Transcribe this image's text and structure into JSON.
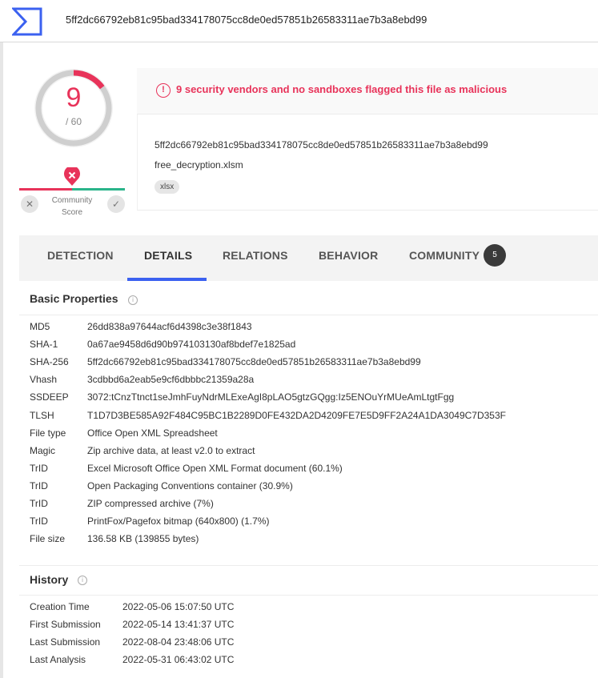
{
  "search": {
    "value": "5ff2dc66792eb81c95bad334178075cc8de0ed57851b26583311ae7b3a8ebd99"
  },
  "score": {
    "detected": "9",
    "total": "/ 60",
    "fraction": 0.15,
    "color": "#e8335a"
  },
  "community": {
    "label_line1": "Community",
    "label_line2": "Score",
    "down_icon": "close-icon",
    "up_icon": "check-icon"
  },
  "alert": {
    "text": "9 security vendors and no sandboxes flagged this file as malicious",
    "icon": "!"
  },
  "file": {
    "hash": "5ff2dc66792eb81c95bad334178075cc8de0ed57851b26583311ae7b3a8ebd99",
    "name": "free_decryption.xlsm",
    "tag": "xlsx"
  },
  "tabs": [
    {
      "label": "DETECTION"
    },
    {
      "label": "DETAILS"
    },
    {
      "label": "RELATIONS"
    },
    {
      "label": "BEHAVIOR"
    },
    {
      "label": "COMMUNITY"
    }
  ],
  "community_count": "5",
  "basic": {
    "title": "Basic Properties",
    "rows": [
      {
        "k": "MD5",
        "v": "26dd838a97644acf6d4398c3e38f1843"
      },
      {
        "k": "SHA-1",
        "v": "0a67ae9458d6d90b974103130af8bdef7e1825ad"
      },
      {
        "k": "SHA-256",
        "v": "5ff2dc66792eb81c95bad334178075cc8de0ed57851b26583311ae7b3a8ebd99"
      },
      {
        "k": "Vhash",
        "v": "3cdbbd6a2eab5e9cf6dbbbc21359a28a"
      },
      {
        "k": "SSDEEP",
        "v": "3072:tCnzTtnct1seJmhFuyNdrMLExeAgI8pLAO5gtzGQgg:Iz5ENOuYrMUeAmLtgtFgg"
      },
      {
        "k": "TLSH",
        "v": "T1D7D3BE585A92F484C95BC1B2289D0FE432DA2D4209FE7E5D9FF2A24A1DA3049C7D353F"
      },
      {
        "k": "File type",
        "v": "Office Open XML Spreadsheet"
      },
      {
        "k": "Magic",
        "v": "Zip archive data, at least v2.0 to extract"
      },
      {
        "k": "TrID",
        "v": "Excel Microsoft Office Open XML Format document (60.1%)"
      },
      {
        "k": "TrID",
        "v": "Open Packaging Conventions container (30.9%)"
      },
      {
        "k": "TrID",
        "v": "ZIP compressed archive (7%)"
      },
      {
        "k": "TrID",
        "v": "PrintFox/Pagefox bitmap (640x800) (1.7%)"
      },
      {
        "k": "File size",
        "v": "136.58 KB (139855 bytes)"
      }
    ]
  },
  "history": {
    "title": "History",
    "rows": [
      {
        "k": "Creation Time",
        "v": "2022-05-06 15:07:50 UTC"
      },
      {
        "k": "First Submission",
        "v": "2022-05-14 13:41:37 UTC"
      },
      {
        "k": "Last Submission",
        "v": "2022-08-04 23:48:06 UTC"
      },
      {
        "k": "Last Analysis",
        "v": "2022-05-31 06:43:02 UTC"
      }
    ]
  },
  "colors": {
    "accent": "#3b61f0",
    "danger": "#e8335a",
    "good": "#2ab48a"
  }
}
